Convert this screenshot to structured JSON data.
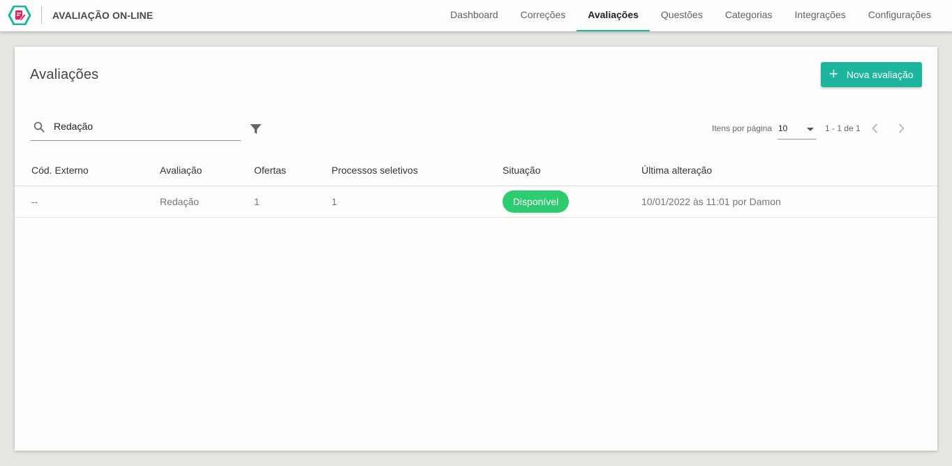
{
  "app": {
    "title": "AVALIAÇÃO ON-LINE",
    "logo_icon": "document-edit-hexagon-icon"
  },
  "nav": {
    "items": [
      {
        "label": "Dashboard"
      },
      {
        "label": "Correções"
      },
      {
        "label": "Avaliações"
      },
      {
        "label": "Questões"
      },
      {
        "label": "Categorias"
      },
      {
        "label": "Integrações"
      },
      {
        "label": "Configurações"
      }
    ],
    "active": "Avaliações"
  },
  "page": {
    "title": "Avaliações",
    "new_button": "Nova avaliação"
  },
  "search": {
    "value": "Redação",
    "icon": "search-icon"
  },
  "pagination": {
    "items_per_page_label": "Itens por página",
    "items_per_page_value": "10",
    "range": "1 - 1 de 1"
  },
  "table": {
    "columns": [
      "Cód. Externo",
      "Avaliação",
      "Ofertas",
      "Processos seletivos",
      "Situação",
      "Última alteração"
    ],
    "rows": [
      {
        "codigo": "--",
        "avaliacao": "Redação",
        "ofertas": "1",
        "processos": "1",
        "situacao": "Disponível",
        "ultima_alteracao": "10/01/2022 às 11:01 por Damon"
      }
    ]
  },
  "colors": {
    "accent": "#1eb59e",
    "status_available": "#2ecc71",
    "logo_hex": "#1eb59e",
    "logo_doc": "#e0245e"
  }
}
